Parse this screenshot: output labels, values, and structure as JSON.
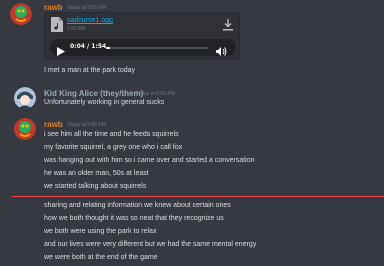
{
  "colors": {
    "background": "#36393f",
    "rawb_name": "#e67e22",
    "alice_name": "#99aab5",
    "link": "#00b0f4",
    "new_divider": "#f04747"
  },
  "messages": [
    {
      "author": "rawb",
      "timestamp": "Today at 5:05 PM",
      "attachment": {
        "icon": "music-file-icon",
        "file_name": "sadcurse1.ogg",
        "file_size": "1.92 MB",
        "current_time": "0:04 / 1:54",
        "progress": 0.035
      },
      "lines": [
        "I met a man at the park today"
      ]
    },
    {
      "author": "Kid King Alice (they/them)",
      "timestamp": "Today at 5:06 PM",
      "lines": [
        "Unfortunately working in general sucks"
      ]
    },
    {
      "author": "rawb",
      "timestamp": "Today at 5:06 PM",
      "lines": [
        "i see him all the time and he feeds squirrels",
        "my favorite squirrel, a grey one who i call fox",
        "was hanging out with him so i came over and started a conversation",
        "he was an older man, 50s at least",
        "we started talking about squirrels",
        "sharing and relating information we knew about certain ones",
        "how we both thought it was so neat that they recognize us",
        "we both were using the park to relax",
        "and our lives were very different but we had the same mental energy",
        "we were both at the end of the game"
      ]
    }
  ]
}
